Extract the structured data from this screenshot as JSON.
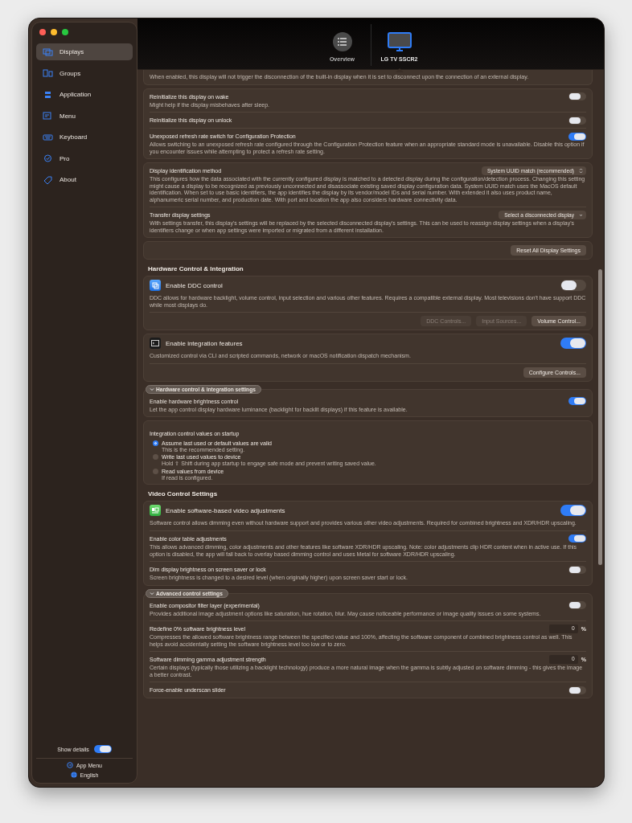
{
  "sidebar": {
    "items": [
      {
        "label": "Displays",
        "selected": true
      },
      {
        "label": "Groups",
        "selected": false
      },
      {
        "label": "Application",
        "selected": false
      },
      {
        "label": "Menu",
        "selected": false
      },
      {
        "label": "Keyboard",
        "selected": false
      },
      {
        "label": "Pro",
        "selected": false
      },
      {
        "label": "About",
        "selected": false
      }
    ],
    "show_details": {
      "label": "Show details",
      "on": true
    },
    "footer": [
      {
        "label": "App Menu"
      },
      {
        "label": "English"
      }
    ]
  },
  "header": {
    "tabs": [
      {
        "label": "Overview",
        "selected": false,
        "kind": "overview"
      },
      {
        "label": "LG TV SSCR2",
        "selected": true,
        "kind": "display"
      }
    ]
  },
  "blocks": [
    {
      "kind": "card",
      "rows": [
        {
          "kind": "note",
          "description": "When enabled, this display will not trigger the disconnection of the built-in display when it is set to disconnect upon the connection of an external display."
        }
      ]
    },
    {
      "kind": "card",
      "rows": [
        {
          "kind": "toggle",
          "title": "Reinitialize this display on wake",
          "description": "Might help if the display misbehaves after sleep.",
          "on": false
        },
        {
          "kind": "toggle",
          "title": "Reinitialize this display on unlock",
          "on": false
        },
        {
          "kind": "toggle",
          "title": "Unexposed refresh rate switch for Configuration Protection",
          "description": "Allows switching to an unexposed refresh rate configured through the Configuration Protection feature when an appropriate standard mode is unavailable. Disable this option if you encounter issues while attempting to protect a refresh rate setting.",
          "on": true
        }
      ]
    },
    {
      "kind": "card",
      "rows": [
        {
          "kind": "select",
          "title": "Display identification method",
          "value": "System UUID match (recommended)",
          "description": "This configures how the data associated with the currently configured display is matched to a detected display during the configuration/detection process. Changing this setting might cause a display to be recognized as previously unconnected and disassociate existing saved display configuration data. System UUID match uses the MacOS default identification. When set to use basic identifiers, the app identifies the display by its vendor/model IDs and serial number. With extended it also uses product name, alphanumeric serial number, and production date. With port and location the app also considers hardware connectivity data."
        },
        {
          "kind": "select",
          "title": "Transfer display settings",
          "value": "Select a disconnected display",
          "description": "With settings transfer, this display's settings will be replaced by the selected disconnected display's settings. This can be used to reassign display settings when a display's identifiers change or when app settings were imported or migrated from a different installation."
        }
      ]
    },
    {
      "kind": "card",
      "rows": [
        {
          "kind": "buttons",
          "buttons": [
            {
              "label": "Reset All Display Settings",
              "disabled": false
            }
          ]
        }
      ]
    },
    {
      "kind": "heading",
      "title": "Hardware Control & Integration"
    },
    {
      "kind": "card",
      "rows": [
        {
          "kind": "feature",
          "title": "Enable DDC control",
          "on": false,
          "description": "DDC allows for hardware backlight, volume control, input selection and various other features. Requires a compatible external display. Most televisions don't have support DDC while most displays do."
        },
        {
          "kind": "buttons",
          "buttons": [
            {
              "label": "DDC Controls...",
              "disabled": true
            },
            {
              "label": "Input Sources...",
              "disabled": true
            },
            {
              "label": "Volume Control...",
              "disabled": false
            }
          ]
        }
      ]
    },
    {
      "kind": "card",
      "rows": [
        {
          "kind": "feature",
          "title": "Enable integration features",
          "on": true,
          "description": "Customized control via CLI and scripted commands, network or macOS notification dispatch mechanism."
        },
        {
          "kind": "buttons",
          "buttons": [
            {
              "label": "Configure Controls...",
              "disabled": false
            }
          ]
        }
      ]
    },
    {
      "kind": "disclosure",
      "label": "Hardware control & integration settings",
      "expanded": true,
      "rows": [
        {
          "kind": "toggle",
          "title": "Enable hardware brightness control",
          "description": "Let the app control display hardware luminance (backlight for backlit displays) if this feature is available.",
          "on": true
        }
      ]
    },
    {
      "kind": "card",
      "rows": [
        {
          "kind": "radio",
          "title": "Integration control values on startup",
          "options": [
            {
              "label": "Assume last used or default values are valid",
              "note": "This is the recommended setting.",
              "selected": true
            },
            {
              "label": "Write last used values to device",
              "note": "Hold ⇧ Shift during app startup to engage safe mode and prevent writing saved value.",
              "selected": false
            },
            {
              "label": "Read values from device",
              "note": "If read is configured.",
              "selected": false
            }
          ]
        }
      ]
    },
    {
      "kind": "heading",
      "title": "Video Control Settings"
    },
    {
      "kind": "card",
      "rows": [
        {
          "kind": "feature",
          "title": "Enable software-based video adjustments",
          "on": true,
          "description": "Software control allows dimming even without hardware support and provides various other video adjustments. Required for combined brightness and XDR/HDR upscaling."
        },
        {
          "kind": "toggle",
          "title": "Enable color table adjustments",
          "on": true,
          "description": "This allows advanced dimming, color adjustments and other features like software XDR/HDR upscaling. Note: color adjustments clip HDR content when in active use. If this option is disabled, the app will fall back to overlay based dimming control and uses Metal for software XDR/HDR upscaling."
        },
        {
          "kind": "toggle",
          "title": "Dim display brightness on screen saver or lock",
          "on": false,
          "description": "Screen brightness is changed to a desired level (when originally higher) upon screen saver start or lock."
        }
      ]
    },
    {
      "kind": "disclosure",
      "label": "Advanced control settings",
      "expanded": true,
      "rows": [
        {
          "kind": "toggle",
          "title": "Enable compositor filter layer (experimental)",
          "on": false,
          "description": "Provides additional image adjustment options like saturation, hue rotation, blur. May cause noticeable performance or image quality issues on some systems."
        },
        {
          "kind": "number",
          "title": "Redefine 0% software brightness level",
          "value": "0",
          "unit": "%",
          "description": "Compresses the allowed software brightness range between the specified value and 100%, affecting the software component of combined brightness control as well. This helps avoid accidentally setting the software brightness level too low or to zero."
        },
        {
          "kind": "number",
          "title": "Software dimming gamma adjustment strength",
          "value": "0",
          "unit": "%",
          "description": "Certain displays (typically those utilizing a backlight technology) produce a more natural image when the gamma is subtly adjusted on software dimming - this gives the image a better contrast."
        },
        {
          "kind": "toggle",
          "title": "Force-enable underscan slider",
          "on": false
        }
      ]
    }
  ]
}
